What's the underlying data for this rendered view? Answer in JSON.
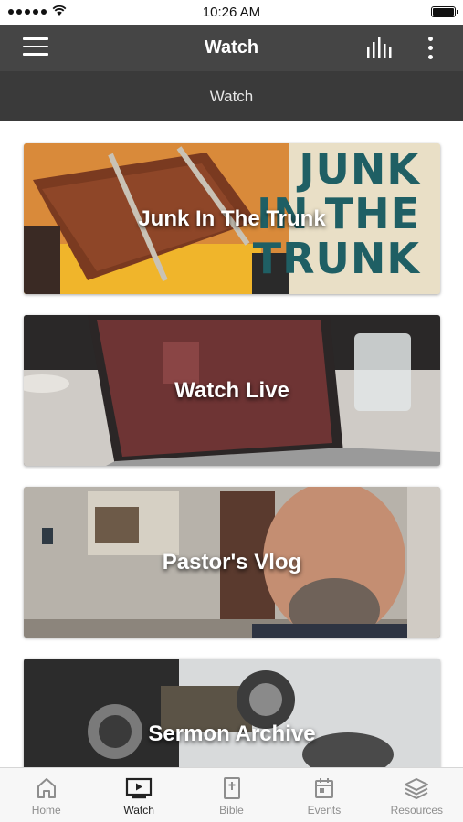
{
  "status_bar": {
    "time": "10:26 AM"
  },
  "nav": {
    "title": "Watch",
    "menu_icon": "hamburger-menu-icon",
    "audio_icon": "audio-bars-icon",
    "more_icon": "vertical-dots-icon"
  },
  "section": {
    "title": "Watch"
  },
  "cards": [
    {
      "label": "Junk In The Trunk",
      "artwork_text": [
        "JUNK",
        "IN THE",
        "TRUNK"
      ]
    },
    {
      "label": "Watch Live"
    },
    {
      "label": "Pastor's Vlog"
    },
    {
      "label": "Sermon Archive"
    }
  ],
  "tabs": [
    {
      "label": "Home",
      "icon": "home-icon",
      "active": false
    },
    {
      "label": "Watch",
      "icon": "video-player-icon",
      "active": true
    },
    {
      "label": "Bible",
      "icon": "bible-icon",
      "active": false
    },
    {
      "label": "Events",
      "icon": "calendar-icon",
      "active": false
    },
    {
      "label": "Resources",
      "icon": "layers-icon",
      "active": false
    }
  ],
  "colors": {
    "nav_background": "#454545",
    "section_background": "#3a3a3a",
    "tab_active": "#222222",
    "tab_inactive": "#8e8e8e"
  }
}
